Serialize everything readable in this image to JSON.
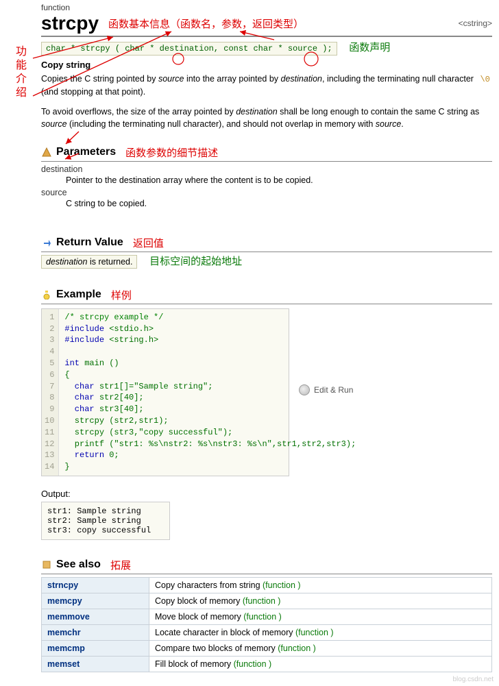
{
  "header": {
    "kicker": "function",
    "name": "strcpy",
    "include": "<cstring>"
  },
  "annotations": {
    "headerInfo": "函数基本信息（函数名，参数，返回类型）",
    "signature": "函数声明",
    "intro": "功能介绍",
    "params": "函数参数的细节描述",
    "return": "返回值",
    "returnDetail": "目标空间的起始地址",
    "example": "样例",
    "seealso": "拓展"
  },
  "signature": "char * strcpy ( char * destination, const char * source );",
  "copyTitle": "Copy string",
  "desc": {
    "p1a": "Copies the C string pointed by ",
    "p1b": " into the array pointed by ",
    "p1c": ", including the terminating null character ",
    "p1d": "(and stopping at that point).",
    "nullchar": "\\0",
    "p2a": "To avoid overflows, the size of the array pointed by ",
    "p2b": " shall be long enough to contain the same C string as ",
    "p2c": " (including the terminating null character), and should not overlap in memory with ",
    "p2d": ".",
    "source": "source",
    "destination": "destination"
  },
  "sections": {
    "parameters": "Parameters",
    "return": "Return Value",
    "example": "Example",
    "seealso": "See also"
  },
  "params": {
    "dest": {
      "name": "destination",
      "text": "Pointer to the destination array where the content is to be copied."
    },
    "src": {
      "name": "source",
      "text": "C string to be copied."
    }
  },
  "returnValue": {
    "a": "destination",
    "b": " is returned."
  },
  "example": {
    "linenums": " 1\n 2\n 3\n 4\n 5\n 6\n 7\n 8\n 9\n10\n11\n12\n13\n14",
    "l1": "/* strcpy example */",
    "l2a": "#include ",
    "l2b": "<stdio.h>",
    "l3a": "#include ",
    "l3b": "<string.h>",
    "l5a": "int",
    "l5b": " main ()",
    "l6": "{",
    "l7a": "  char",
    "l7b": " str1[]=\"Sample string\";",
    "l8a": "  char",
    "l8b": " str2[40];",
    "l9a": "  char",
    "l9b": " str3[40];",
    "l10": "  strcpy (str2,str1);",
    "l11": "  strcpy (str3,\"copy successful\");",
    "l12": "  printf (\"str1: %s\\nstr2: %s\\nstr3: %s\\n\",str1,str2,str3);",
    "l13a": "  return",
    "l13b": " 0;",
    "l14": "}",
    "editrun": "Edit & Run"
  },
  "output": {
    "label": "Output:",
    "text": "str1: Sample string\nstr2: Sample string\nstr3: copy successful"
  },
  "seealso": [
    {
      "name": "strncpy",
      "desc": "Copy characters from string ",
      "tag": "(function )"
    },
    {
      "name": "memcpy",
      "desc": "Copy block of memory ",
      "tag": "(function )"
    },
    {
      "name": "memmove",
      "desc": "Move block of memory ",
      "tag": "(function )"
    },
    {
      "name": "memchr",
      "desc": "Locate character in block of memory ",
      "tag": "(function )"
    },
    {
      "name": "memcmp",
      "desc": "Compare two blocks of memory ",
      "tag": "(function )"
    },
    {
      "name": "memset",
      "desc": "Fill block of memory ",
      "tag": "(function )"
    }
  ],
  "watermark": "blog.csdn.net"
}
